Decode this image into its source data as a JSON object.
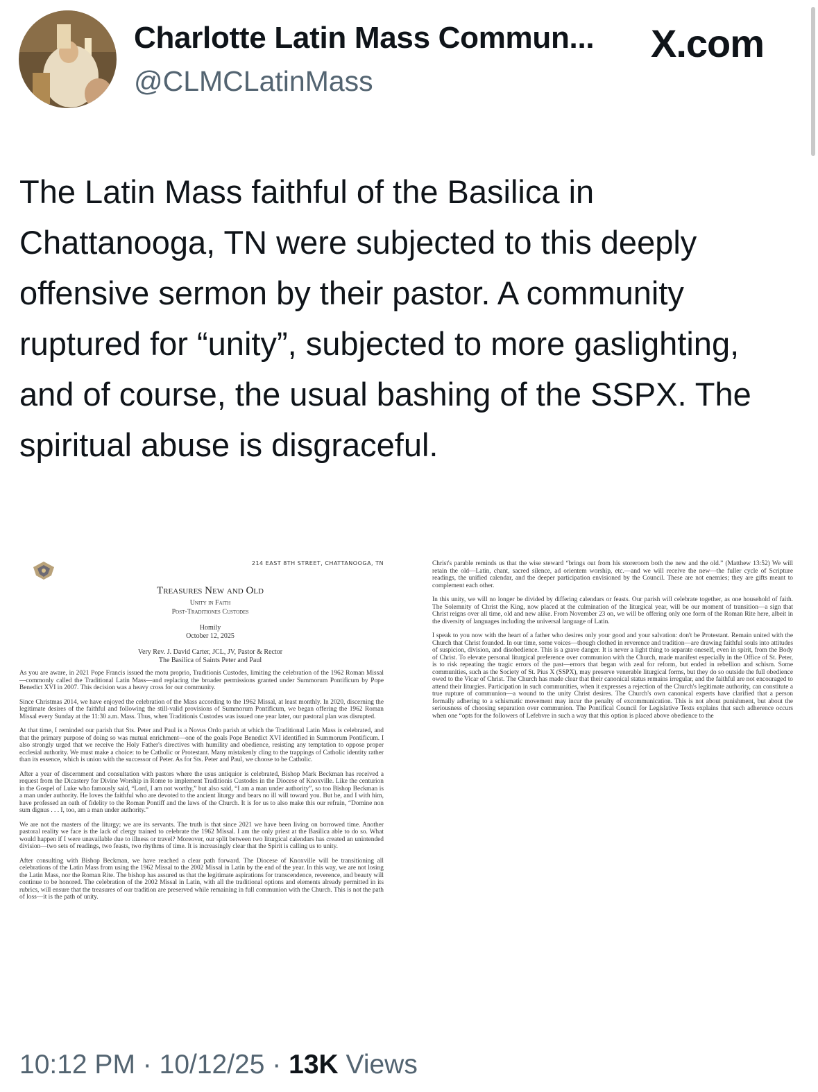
{
  "tweet": {
    "display_name": "Charlotte Latin Mass Commun...",
    "handle": "@CLMCLatinMass",
    "site": "X.com",
    "text": "The Latin Mass faithful of the Basilica in Chattanooga, TN were subjected to this deeply offensive sermon by their pastor. A community ruptured for “unity”, subjected to more gaslighting, and of course, the usual bashing of the SSPX. The spiritual abuse is disgraceful.",
    "time": "10:12 PM",
    "date": "10/12/25",
    "views_count": "13K",
    "views_label": "Views",
    "separator": "·"
  },
  "document": {
    "address": "214 EAST 8TH STREET, CHATTANOOGA, TN",
    "title": "Treasures New and Old",
    "subtitle_1": "Unity in Faith",
    "subtitle_2": "Post-Traditiones Custodes",
    "type": "Homily",
    "date": "October 12, 2025",
    "author": "Very Rev. J. David Carter, JCL, JV, Pastor & Rector",
    "church": "The Basilica of Saints Peter and Paul",
    "left_paragraphs": [
      "As you are aware, in 2021 Pope Francis issued the motu proprio, Traditionis Custodes, limiting the celebration of the 1962 Roman Missal—commonly called the Traditional Latin Mass—and replacing the broader permissions granted under Summorum Pontificum by Pope Benedict XVI in 2007. This decision was a heavy cross for our community.",
      "Since Christmas 2014, we have enjoyed the celebration of the Mass according to the 1962 Missal, at least monthly. In 2020, discerning the legitimate desires of the faithful and following the still-valid provisions of Summorum Pontificum, we began offering the 1962 Roman Missal every Sunday at the 11:30 a.m. Mass. Thus, when Traditionis Custodes was issued one year later, our pastoral plan was disrupted.",
      "At that time, I reminded our parish that Sts. Peter and Paul is a Novus Ordo parish at which the Traditional Latin Mass is celebrated, and that the primary purpose of doing so was mutual enrichment—one of the goals Pope Benedict XVI identified in Summorum Pontificum. I also strongly urged that we receive the Holy Father's directives with humility and obedience, resisting any temptation to oppose proper ecclesial authority. We must make a choice: to be Catholic or Protestant. Many mistakenly cling to the trappings of Catholic identity rather than its essence, which is union with the successor of Peter. As for Sts. Peter and Paul, we choose to be Catholic.",
      "After a year of discernment and consultation with pastors where the usus antiquior is celebrated, Bishop Mark Beckman has received a request from the Dicastery for Divine Worship in Rome to implement Traditionis Custodes in the Diocese of Knoxville. Like the centurion in the Gospel of Luke who famously said, “Lord, I am not worthy,” but also said, “I am a man under authority”, so too Bishop Beckman is a man under authority. He loves the faithful who are devoted to the ancient liturgy and bears no ill will toward you. But he, and I with him, have professed an oath of fidelity to the Roman Pontiff and the laws of the Church. It is for us to also make this our refrain, “Domine non sum dignus . . . I, too, am a man under authority.”",
      "We are not the masters of the liturgy; we are its servants. The truth is that since 2021 we have been living on borrowed time. Another pastoral reality we face is the lack of clergy trained to celebrate the 1962 Missal. I am the only priest at the Basilica able to do so. What would happen if I were unavailable due to illness or travel? Moreover, our split between two liturgical calendars has created an unintended division—two sets of readings, two feasts, two rhythms of time. It is increasingly clear that the Spirit is calling us to unity.",
      "After consulting with Bishop Beckman, we have reached a clear path forward. The Diocese of Knoxville will be transitioning all celebrations of the Latin Mass from using the 1962 Missal to the 2002 Missal in Latin by the end of the year. In this way, we are not losing the Latin Mass, nor the Roman Rite. The bishop has assured us that the legitimate aspirations for transcendence, reverence, and beauty will continue to be honored. The celebration of the 2002 Missal in Latin, with all the traditional options and elements already permitted in its rubrics, will ensure that the treasures of our tradition are preserved while remaining in full communion with the Church. This is not the path of loss—it is the path of unity."
    ],
    "right_paragraphs": [
      "Christ's parable reminds us that the wise steward “brings out from his storeroom both the new and the old.” (Matthew 13:52) We will retain the old—Latin, chant, sacred silence, ad orientem worship, etc.—and we will receive the new—the fuller cycle of Scripture readings, the unified calendar, and the deeper participation envisioned by the Council. These are not enemies; they are gifts meant to complement each other.",
      "In this unity, we will no longer be divided by differing calendars or feasts. Our parish will celebrate together, as one household of faith. The Solemnity of Christ the King, now placed at the culmination of the liturgical year, will be our moment of transition—a sign that Christ reigns over all time, old and new alike. From November 23 on, we will be offering only one form of the Roman Rite here, albeit in the diversity of languages including the universal language of Latin.",
      "I speak to you now with the heart of a father who desires only your good and your salvation: don't be Protestant. Remain united with the Church that Christ founded. In our time, some voices—though clothed in reverence and tradition—are drawing faithful souls into attitudes of suspicion, division, and disobedience. This is a grave danger. It is never a light thing to separate oneself, even in spirit, from the Body of Christ. To elevate personal liturgical preference over communion with the Church, made manifest especially in the Office of St. Peter, is to risk repeating the tragic errors of the past—errors that began with zeal for reform, but ended in rebellion and schism. Some communities, such as the Society of St. Pius X (SSPX), may preserve venerable liturgical forms, but they do so outside the full obedience owed to the Vicar of Christ. The Church has made clear that their canonical status remains irregular, and the faithful are not encouraged to attend their liturgies. Participation in such communities, when it expresses a rejection of the Church's legitimate authority, can constitute a true rupture of communion—a wound to the unity Christ desires. The Church's own canonical experts have clarified that a person formally adhering to a schismatic movement may incur the penalty of excommunication. This is not about punishment, but about the seriousness of choosing separation over communion. The Pontifical Council for Legislative Texts explains that such adherence occurs when one “opts for the followers of Lefebvre in such a way that this option is placed above obedience to the"
    ]
  }
}
